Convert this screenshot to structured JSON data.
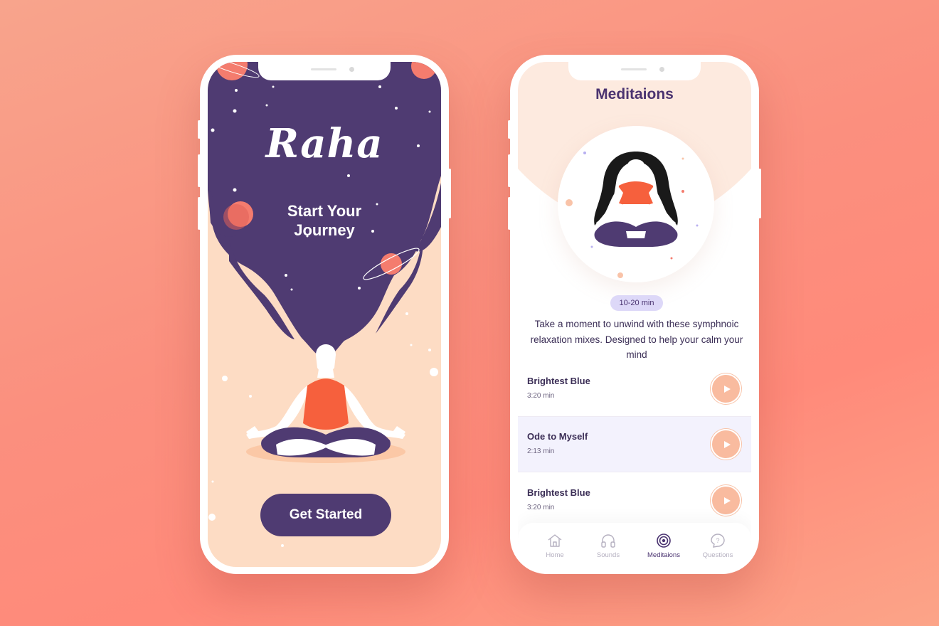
{
  "colors": {
    "accent": "#4f3b72",
    "peach": "#fddcc4",
    "play": "#f9bb9f",
    "badge": "#ddd8f8"
  },
  "splash": {
    "logo": "Raha",
    "tagline_line1": "Start Your",
    "tagline_line2": "Journey",
    "cta_label": "Get Started"
  },
  "meditations": {
    "title": "Meditaions",
    "duration_badge": "10-20 min",
    "description": "Take a moment to unwind with these symphnoic relaxation mixes. Designed to help your calm your mind",
    "tracks": [
      {
        "title": "Brightest Blue",
        "duration": "3:20 min"
      },
      {
        "title": "Ode to Myself",
        "duration": "2:13 min"
      },
      {
        "title": "Brightest Blue",
        "duration": "3:20 min"
      }
    ],
    "tabs": [
      {
        "label": "Home",
        "icon": "home-icon"
      },
      {
        "label": "Sounds",
        "icon": "headphones-icon"
      },
      {
        "label": "Meditaions",
        "icon": "target-icon",
        "active": true
      },
      {
        "label": "Questions",
        "icon": "question-icon"
      }
    ]
  }
}
